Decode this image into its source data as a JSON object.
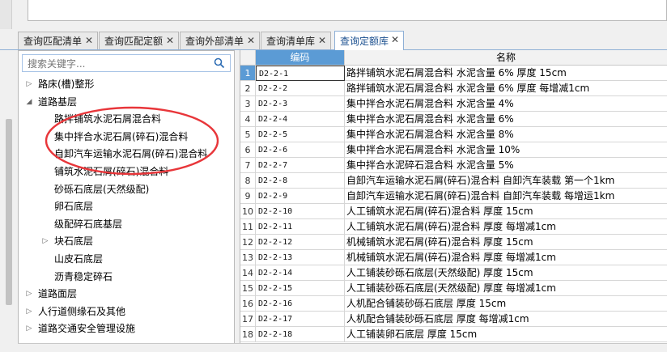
{
  "tabs": [
    {
      "label": "查询匹配清单",
      "close": "✕"
    },
    {
      "label": "查询匹配定额",
      "close": "✕"
    },
    {
      "label": "查询外部清单",
      "close": "✕"
    },
    {
      "label": "查询清单库",
      "close": "✕"
    },
    {
      "label": "查询定额库",
      "close": "✕"
    }
  ],
  "search": {
    "placeholder": "搜索关键字..."
  },
  "tree": [
    {
      "label": "路床(槽)整形",
      "arrow": "▷"
    },
    {
      "label": "道路基层",
      "arrow": "◢"
    },
    {
      "label": "路拌铺筑水泥石屑混合料",
      "arrow": ""
    },
    {
      "label": "集中拌合水泥石屑(碎石)混合料",
      "arrow": ""
    },
    {
      "label": "自卸汽车运输水泥石屑(碎石)混合料",
      "arrow": ""
    },
    {
      "label": "铺筑水泥石屑(碎石)混合料",
      "arrow": ""
    },
    {
      "label": "砂砾石底层(天然级配)",
      "arrow": ""
    },
    {
      "label": "卵石底层",
      "arrow": ""
    },
    {
      "label": "级配碎石底基层",
      "arrow": ""
    },
    {
      "label": "块石底层",
      "arrow": "▷"
    },
    {
      "label": "山皮石底层",
      "arrow": ""
    },
    {
      "label": "沥青稳定碎石",
      "arrow": ""
    },
    {
      "label": "道路面层",
      "arrow": "▷"
    },
    {
      "label": "人行道侧缘石及其他",
      "arrow": "▷"
    },
    {
      "label": "道路交通安全管理设施",
      "arrow": "▷"
    }
  ],
  "grid": {
    "col_code": "编码",
    "col_name": "名称",
    "rows": [
      {
        "n": "1",
        "code": "D2-2-1",
        "name": "路拌铺筑水泥石屑混合料 水泥含量 6% 厚度 15cm"
      },
      {
        "n": "2",
        "code": "D2-2-2",
        "name": "路拌铺筑水泥石屑混合料 水泥含量 6% 厚度 每增减1cm"
      },
      {
        "n": "3",
        "code": "D2-2-3",
        "name": "集中拌合水泥石屑混合料 水泥含量 4%"
      },
      {
        "n": "4",
        "code": "D2-2-4",
        "name": "集中拌合水泥石屑混合料 水泥含量 6%"
      },
      {
        "n": "5",
        "code": "D2-2-5",
        "name": "集中拌合水泥石屑混合料 水泥含量 8%"
      },
      {
        "n": "6",
        "code": "D2-2-6",
        "name": "集中拌合水泥石屑混合料 水泥含量 10%"
      },
      {
        "n": "7",
        "code": "D2-2-7",
        "name": "集中拌合水泥碎石混合料 水泥含量 5%"
      },
      {
        "n": "8",
        "code": "D2-2-8",
        "name": "自卸汽车运输水泥石屑(碎石)混合料 自卸汽车装载 第一个1km"
      },
      {
        "n": "9",
        "code": "D2-2-9",
        "name": "自卸汽车运输水泥石屑(碎石)混合料 自卸汽车装载 每增运1km"
      },
      {
        "n": "10",
        "code": "D2-2-10",
        "name": "人工铺筑水泥石屑(碎石)混合料 厚度 15cm"
      },
      {
        "n": "11",
        "code": "D2-2-11",
        "name": "人工铺筑水泥石屑(碎石)混合料 厚度 每增减1cm"
      },
      {
        "n": "12",
        "code": "D2-2-12",
        "name": "机械铺筑水泥石屑(碎石)混合料 厚度 15cm"
      },
      {
        "n": "13",
        "code": "D2-2-13",
        "name": "机械铺筑水泥石屑(碎石)混合料 厚度 每增减1cm"
      },
      {
        "n": "14",
        "code": "D2-2-14",
        "name": "人工铺装砂砾石底层(天然级配) 厚度 15cm"
      },
      {
        "n": "15",
        "code": "D2-2-15",
        "name": "人工铺装砂砾石底层(天然级配) 厚度 每增减1cm"
      },
      {
        "n": "16",
        "code": "D2-2-16",
        "name": "人机配合铺装砂砾石底层 厚度 15cm"
      },
      {
        "n": "17",
        "code": "D2-2-17",
        "name": "人机配合铺装砂砾石底层 厚度 每增减1cm"
      },
      {
        "n": "18",
        "code": "D2-2-18",
        "name": "人工铺装卵石底层 厚度 15cm"
      }
    ]
  },
  "colors": {
    "accent": "#5b9bd5",
    "annotation": "#e8363a"
  },
  "icons": {
    "search": "search-icon",
    "tree_expand": "expand-arrow-icon",
    "close": "close-icon"
  }
}
